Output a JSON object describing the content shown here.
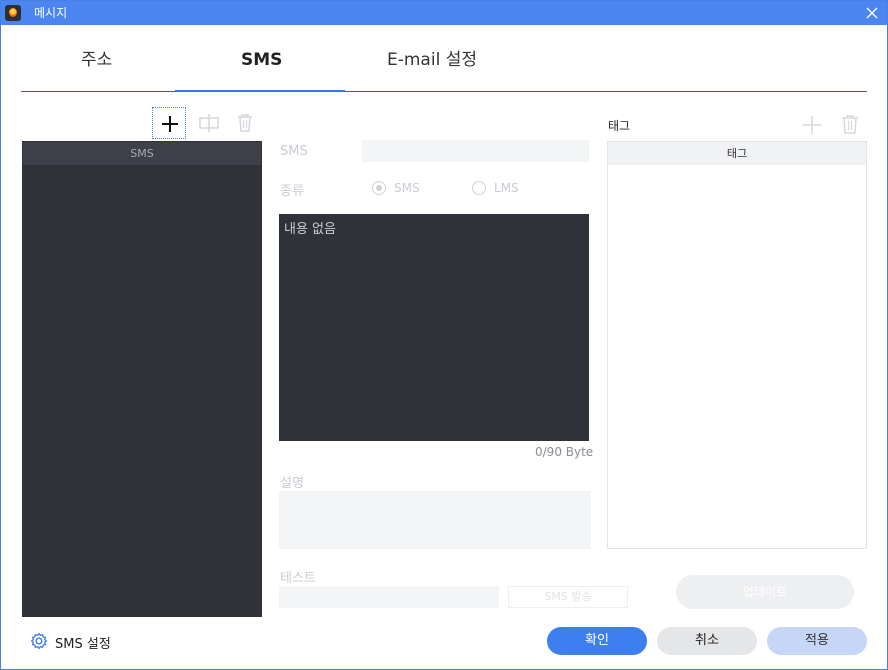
{
  "window": {
    "title": "메시지",
    "accent": "#4b86f0"
  },
  "tabs": [
    {
      "label": "주소"
    },
    {
      "label": "SMS",
      "active": true
    },
    {
      "label": "E-mail 설정"
    }
  ],
  "sms_list": {
    "header": "SMS",
    "items": []
  },
  "form": {
    "sms_label": "SMS",
    "type_label": "종류",
    "type_options": [
      {
        "label": "SMS",
        "selected": true
      },
      {
        "label": "LMS",
        "selected": false
      }
    ],
    "content_placeholder": "내용 없음",
    "byte_count": "0/90 Byte",
    "description_label": "설명",
    "test_label": "테스트",
    "send_button": "SMS 발송"
  },
  "tags": {
    "title": "태그",
    "header": "태그",
    "items": []
  },
  "update_button": "업데이트",
  "footer": {
    "settings_label": "SMS 설정",
    "ok": "확인",
    "cancel": "취소",
    "apply": "적용"
  }
}
